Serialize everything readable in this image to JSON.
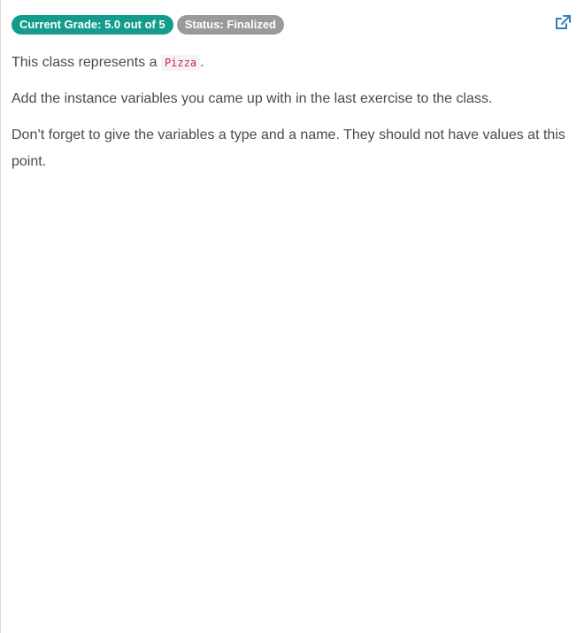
{
  "header": {
    "grade_badge": "Current Grade: 5.0 out of 5",
    "status_badge": "Status: Finalized",
    "open_external_icon": "external-link-icon"
  },
  "colors": {
    "grade_badge_bg": "#139c8e",
    "status_badge_bg": "#9a9a9a",
    "link_icon": "#2f7fc1",
    "code_text": "#c7254e"
  },
  "instructions": {
    "line1_prefix": "This class represents a ",
    "line1_code": "Pizza",
    "line1_suffix": ".",
    "paragraph2": "Add the instance variables you came up with in the last exercise to the class.",
    "paragraph3": "Don’t forget to give the variables a type and a name. They should not have values at this point."
  }
}
